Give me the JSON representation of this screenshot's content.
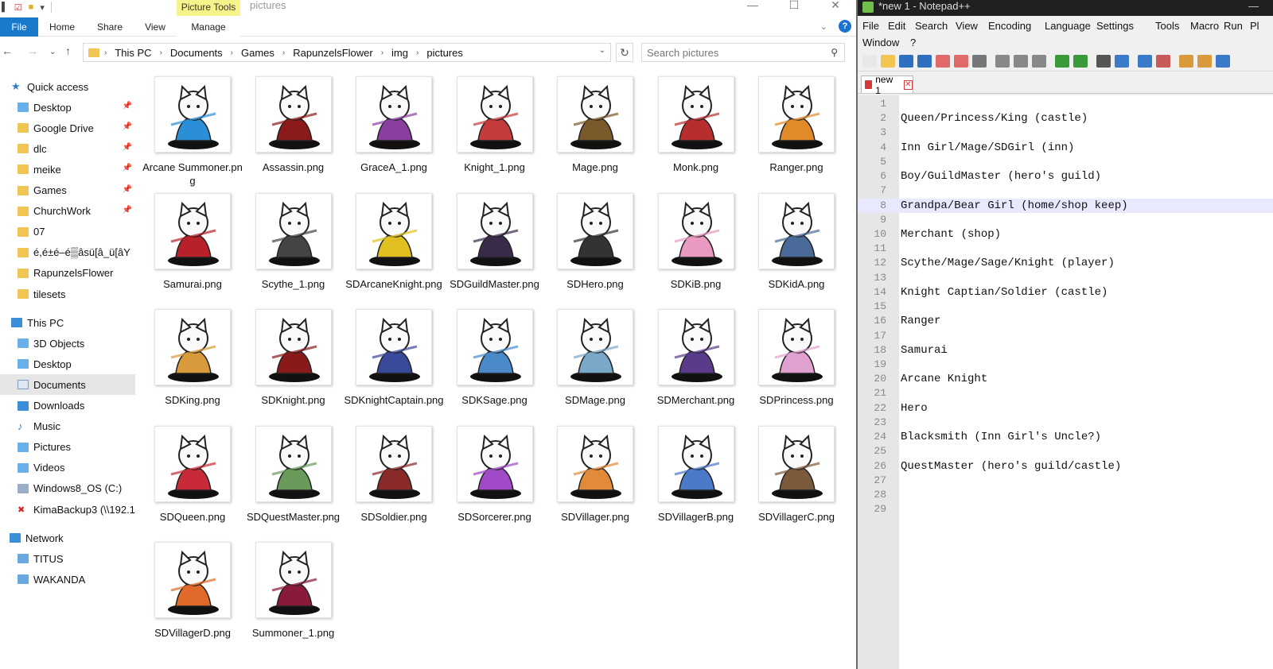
{
  "explorer": {
    "picture_tools_label": "Picture Tools",
    "window_name": "pictures",
    "tabs": [
      "File",
      "Home",
      "Share",
      "View",
      "Manage"
    ],
    "breadcrumb": [
      "This PC",
      "Documents",
      "Games",
      "RapunzelsFlower",
      "img",
      "pictures"
    ],
    "search_placeholder": "Search pictures",
    "nav": [
      {
        "label": "Quick access",
        "type": "star",
        "pinned": false
      },
      {
        "label": "Desktop",
        "type": "folder-blue",
        "pinned": true
      },
      {
        "label": "Google Drive",
        "type": "folder",
        "pinned": true
      },
      {
        "label": "dlc",
        "type": "folder",
        "pinned": true
      },
      {
        "label": "meike",
        "type": "folder",
        "pinned": true
      },
      {
        "label": "Games",
        "type": "folder",
        "pinned": true
      },
      {
        "label": "ChurchWork",
        "type": "folder",
        "pinned": true
      },
      {
        "label": "07",
        "type": "folder",
        "pinned": false
      },
      {
        "label": "é,é±é–é▒âsü[â_ü[âY",
        "type": "folder",
        "pinned": false
      },
      {
        "label": "RapunzelsFlower",
        "type": "folder",
        "pinned": false
      },
      {
        "label": "tilesets",
        "type": "folder",
        "pinned": false
      },
      {
        "label": "This PC",
        "type": "pc",
        "pinned": false
      },
      {
        "label": "3D Objects",
        "type": "folder-blue",
        "pinned": false
      },
      {
        "label": "Desktop",
        "type": "folder-blue",
        "pinned": false
      },
      {
        "label": "Documents",
        "type": "doc",
        "pinned": false,
        "selected": true
      },
      {
        "label": "Downloads",
        "type": "download",
        "pinned": false
      },
      {
        "label": "Music",
        "type": "music",
        "pinned": false
      },
      {
        "label": "Pictures",
        "type": "folder-blue",
        "pinned": false
      },
      {
        "label": "Videos",
        "type": "folder-blue",
        "pinned": false
      },
      {
        "label": "Windows8_OS (C:)",
        "type": "drive",
        "pinned": false
      },
      {
        "label": "KimaBackup3 (\\\\192.1",
        "type": "netdrive",
        "pinned": false
      },
      {
        "label": "Network",
        "type": "network",
        "pinned": false
      },
      {
        "label": "TITUS",
        "type": "computer",
        "pinned": false
      },
      {
        "label": "WAKANDA",
        "type": "computer",
        "pinned": false
      }
    ],
    "files": [
      {
        "name": "Arcane Summoner.png",
        "color": "#2a8fd6"
      },
      {
        "name": "Assassin.png",
        "color": "#8b1a1a"
      },
      {
        "name": "GraceA_1.png",
        "color": "#8a3fa0"
      },
      {
        "name": "Knight_1.png",
        "color": "#c43b3b"
      },
      {
        "name": "Mage.png",
        "color": "#7a5a2a"
      },
      {
        "name": "Monk.png",
        "color": "#b82e2e"
      },
      {
        "name": "Ranger.png",
        "color": "#e08a2a"
      },
      {
        "name": "Samurai.png",
        "color": "#b8202a"
      },
      {
        "name": "Scythe_1.png",
        "color": "#444444"
      },
      {
        "name": "SDArcaneKnight.png",
        "color": "#e0c020"
      },
      {
        "name": "SDGuildMaster.png",
        "color": "#3a2a4a"
      },
      {
        "name": "SDHero.png",
        "color": "#333333"
      },
      {
        "name": "SDKiB.png",
        "color": "#e89ac0"
      },
      {
        "name": "SDKidA.png",
        "color": "#4a6a9a"
      },
      {
        "name": "SDKing.png",
        "color": "#d89a3a"
      },
      {
        "name": "SDKnight.png",
        "color": "#8a1a1a"
      },
      {
        "name": "SDKnightCaptain.png",
        "color": "#3a4a9a"
      },
      {
        "name": "SDKSage.png",
        "color": "#4a8ac8"
      },
      {
        "name": "SDMage.png",
        "color": "#7aa8c8"
      },
      {
        "name": "SDMerchant.png",
        "color": "#5a3a8a"
      },
      {
        "name": "SDPrincess.png",
        "color": "#e0a0d0"
      },
      {
        "name": "SDQueen.png",
        "color": "#c82a3a"
      },
      {
        "name": "SDQuestMaster.png",
        "color": "#6a9a5a"
      },
      {
        "name": "SDSoldier.png",
        "color": "#8a2a2a"
      },
      {
        "name": "SDSorcerer.png",
        "color": "#a04ac8"
      },
      {
        "name": "SDVillager.png",
        "color": "#e08a3a"
      },
      {
        "name": "SDVillagerB.png",
        "color": "#4a7ac8"
      },
      {
        "name": "SDVillagerC.png",
        "color": "#7a5a3a"
      },
      {
        "name": "SDVillagerD.png",
        "color": "#e06a2a"
      },
      {
        "name": "Summoner_1.png",
        "color": "#8a1a3a"
      }
    ]
  },
  "notepad": {
    "title": "*new 1 - Notepad++",
    "menu_row1": [
      "File",
      "Edit",
      "Search",
      "View",
      "Encoding",
      "Language",
      "Settings",
      "Tools",
      "Macro",
      "Run",
      "Pl"
    ],
    "menu_row2": [
      "Window",
      "?"
    ],
    "tab_label": "new 1",
    "current_line": 8,
    "lines": [
      "",
      "Queen/Princess/King (castle)",
      "",
      "Inn Girl/Mage/SDGirl (inn)",
      "",
      "Boy/GuildMaster (hero's guild)",
      "",
      "Grandpa/Bear Girl (home/shop keep)",
      "",
      "Merchant (shop)",
      "",
      "Scythe/Mage/Sage/Knight (player)",
      "",
      "Knight Captian/Soldier (castle)",
      "",
      "Ranger",
      "",
      "Samurai",
      "",
      "Arcane Knight",
      "",
      "Hero",
      "",
      "Blacksmith (Inn Girl's Uncle?)",
      "",
      "QuestMaster (hero's guild/castle)",
      "",
      "",
      ""
    ]
  }
}
